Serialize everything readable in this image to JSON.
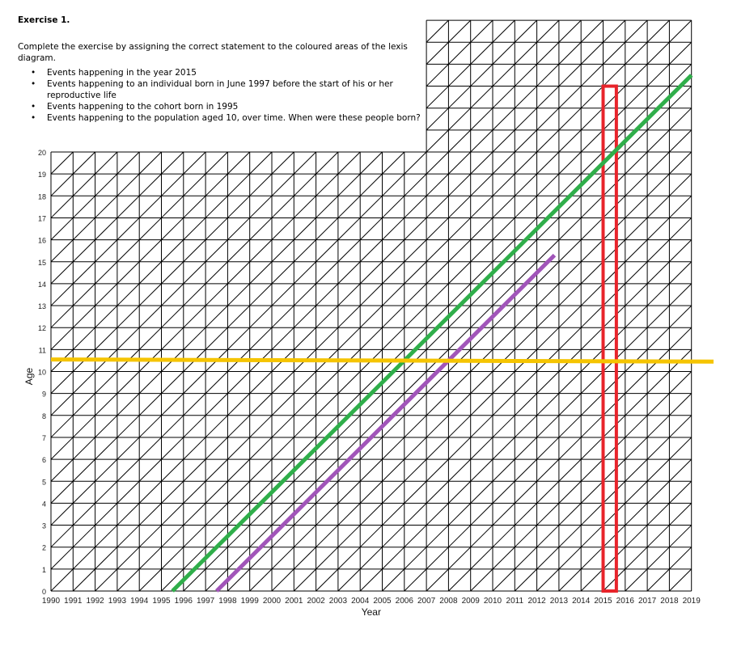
{
  "exercise": {
    "title": "Exercise 1.",
    "instruction": "Complete the exercise by assigning the correct statement to the coloured areas of the lexis diagram.",
    "items": [
      "Events happening in the year 2015",
      "Events happening to an individual born in June 1997 before the start of his or her reproductive life",
      "Events happening to the cohort born in 1995",
      "Events happening to the population aged 10, over time. When were these people born?"
    ]
  },
  "chart_data": {
    "type": "lexis-diagram",
    "xlabel": "Year",
    "ylabel": "Age",
    "x_ticks": [
      "1990",
      "1991",
      "1992",
      "1993",
      "1994",
      "1995",
      "1996",
      "1997",
      "1998",
      "1999",
      "2000",
      "2001",
      "2002",
      "2003",
      "2004",
      "2005",
      "2006",
      "2007",
      "2008",
      "2009",
      "2010",
      "2011",
      "2012",
      "2013",
      "2014",
      "2015",
      "2016",
      "2017",
      "2018",
      "2019"
    ],
    "y_ticks": [
      "0",
      "1",
      "2",
      "3",
      "4",
      "5",
      "6",
      "7",
      "8",
      "9",
      "10",
      "11",
      "12",
      "13",
      "14",
      "15",
      "16",
      "17",
      "18",
      "19",
      "20"
    ],
    "x_range": [
      1990,
      2019
    ],
    "y_range": [
      0,
      20
    ],
    "top_extension": {
      "x_range": [
        2007,
        2019
      ],
      "y_range": [
        20,
        26
      ]
    },
    "highlights": [
      {
        "name": "year-2015-rectangle",
        "shape": "rectangle",
        "color": "#e8242b",
        "x": [
          2015,
          2015.6
        ],
        "y": [
          0,
          23
        ]
      },
      {
        "name": "cohort-1995-line",
        "shape": "line",
        "color": "#2fae4a",
        "from": [
          1995.5,
          0
        ],
        "to": [
          2019,
          23.5
        ]
      },
      {
        "name": "born-june-1997-line",
        "shape": "line",
        "color": "#a155b9",
        "from": [
          1997.5,
          0
        ],
        "to": [
          2012.8,
          15.3
        ]
      },
      {
        "name": "age-10-line",
        "shape": "line",
        "color": "#f5c400",
        "from": [
          1990,
          10.55
        ],
        "to": [
          2020,
          10.45
        ]
      }
    ]
  }
}
